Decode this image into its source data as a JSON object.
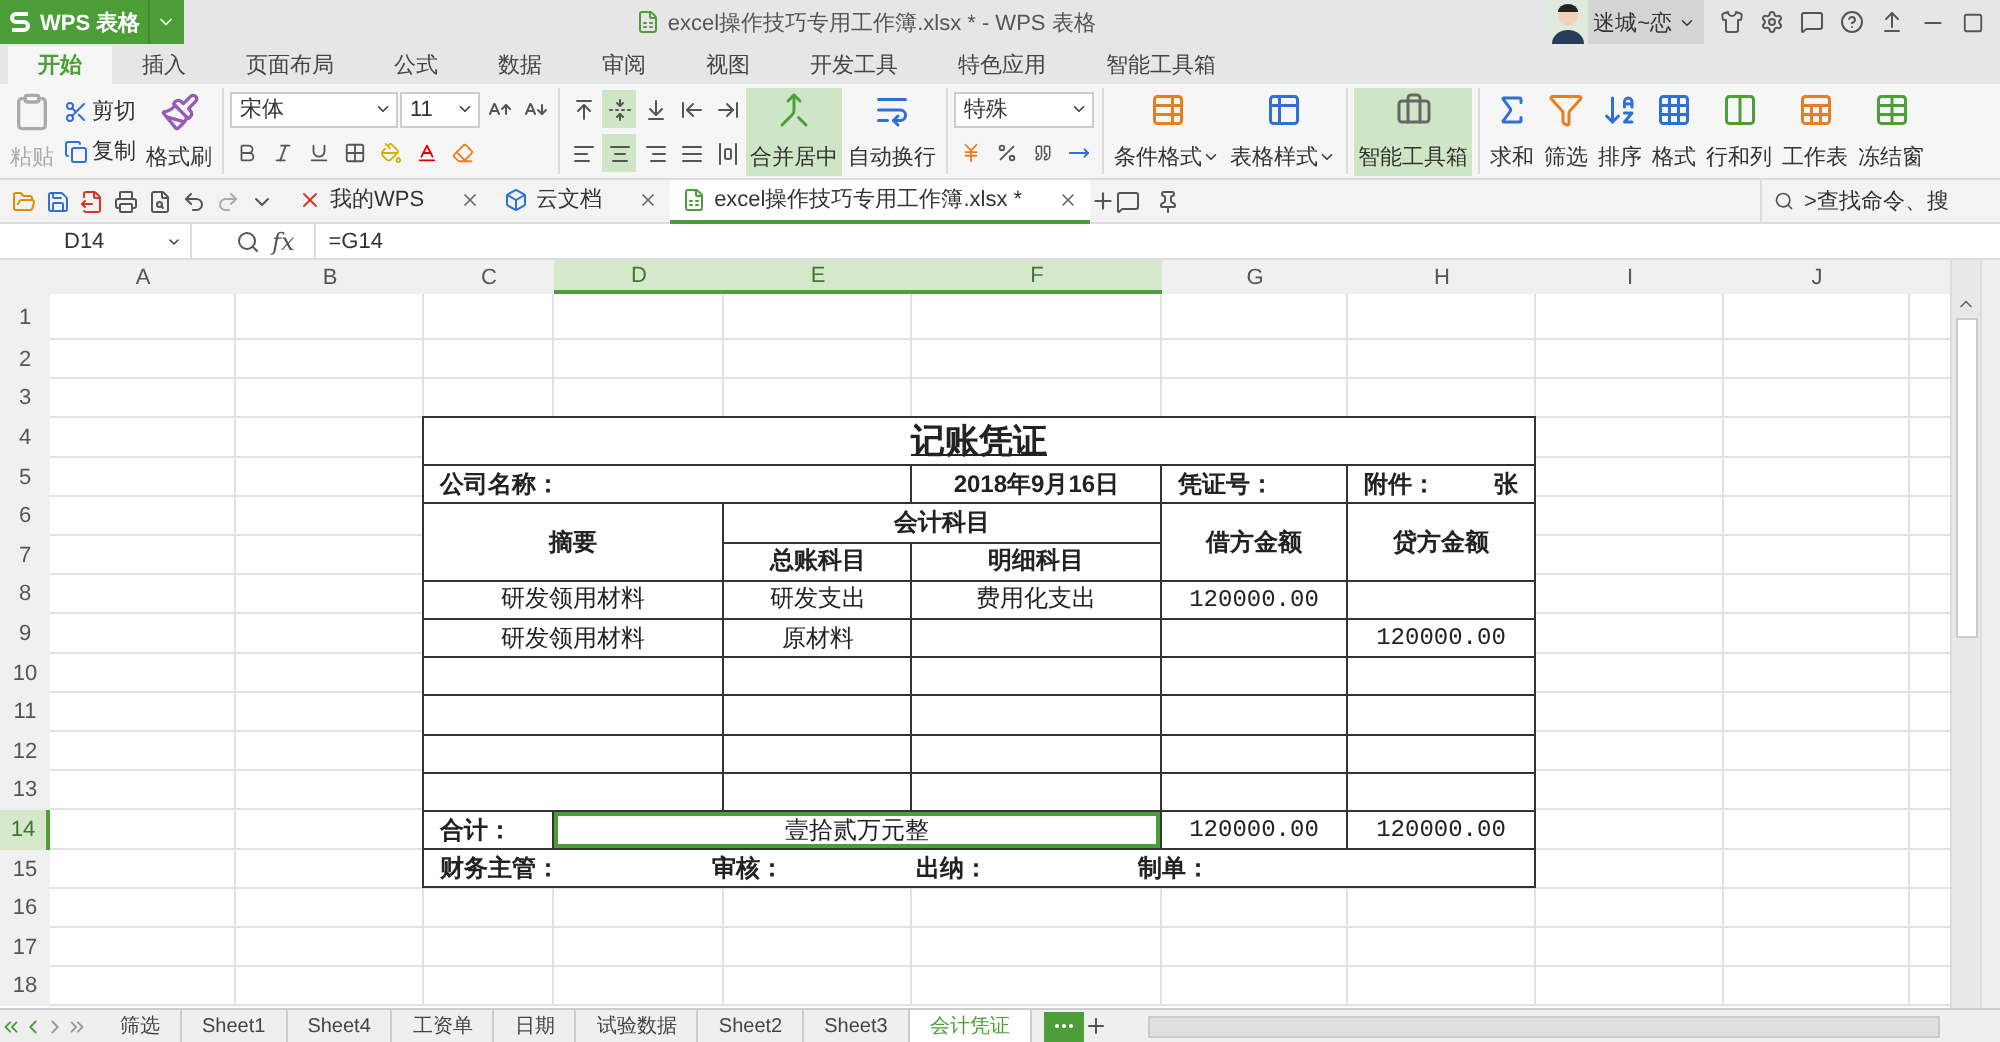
{
  "app_button": {
    "label": "WPS 表格"
  },
  "window": {
    "title": "excel操作技巧专用工作簿.xlsx * - WPS 表格"
  },
  "user": {
    "name": "迷城~恋"
  },
  "ribbon_tabs": [
    {
      "label": "开始",
      "selected": true
    },
    {
      "label": "插入",
      "selected": false
    },
    {
      "label": "页面布局",
      "selected": false
    },
    {
      "label": "公式",
      "selected": false
    },
    {
      "label": "数据",
      "selected": false
    },
    {
      "label": "审阅",
      "selected": false
    },
    {
      "label": "视图",
      "selected": false
    },
    {
      "label": "开发工具",
      "selected": false
    },
    {
      "label": "特色应用",
      "selected": false
    },
    {
      "label": "智能工具箱",
      "selected": false
    }
  ],
  "ribbon": {
    "paste": {
      "label": "粘贴",
      "disabled": true
    },
    "cut": "剪切",
    "copy": "复制",
    "format_painter": "格式刷",
    "font_name": "宋体",
    "font_size": "11",
    "alignment": [
      {
        "kind": "top",
        "selected": false
      },
      {
        "kind": "middle",
        "selected": true
      },
      {
        "kind": "bottom",
        "selected": false
      },
      {
        "kind": "outdent",
        "selected": false
      },
      {
        "kind": "indent",
        "selected": false
      },
      {
        "kind": "left",
        "selected": false
      },
      {
        "kind": "center",
        "selected": true
      },
      {
        "kind": "right",
        "selected": false
      },
      {
        "kind": "justify",
        "selected": false
      },
      {
        "kind": "distributed",
        "selected": false
      }
    ],
    "merge": {
      "label": "合并居中",
      "on": true
    },
    "wrap": "自动换行",
    "number_format": "特殊",
    "styles": [
      "条件格式",
      "表格样式"
    ],
    "toolbox": {
      "label": "智能工具箱",
      "on": true
    },
    "editing": [
      {
        "kind": "sum",
        "label": "求和"
      },
      {
        "kind": "filter",
        "label": "筛选"
      },
      {
        "kind": "sort",
        "label": "排序"
      },
      {
        "kind": "format",
        "label": "格式"
      },
      {
        "kind": "rowscols",
        "label": "行和列"
      },
      {
        "kind": "sheet",
        "label": "工作表"
      },
      {
        "kind": "freeze",
        "label": "冻结窗"
      }
    ]
  },
  "doc_tabs": [
    {
      "kind": "wps",
      "label": "我的WPS",
      "selected": false
    },
    {
      "kind": "cloud",
      "label": "云文档",
      "selected": false
    },
    {
      "kind": "sheet",
      "label": "excel操作技巧专用工作簿.xlsx *",
      "selected": true
    }
  ],
  "command_search": {
    "placeholder": ">查找命令、搜"
  },
  "formula_bar": {
    "cell": "D14",
    "fx": "fx",
    "formula": "=G14"
  },
  "sheet": {
    "columns": [
      {
        "label": "A",
        "selected": false
      },
      {
        "label": "B",
        "selected": false
      },
      {
        "label": "C",
        "selected": false
      },
      {
        "label": "D",
        "selected": true
      },
      {
        "label": "E",
        "selected": true
      },
      {
        "label": "F",
        "selected": true
      },
      {
        "label": "G",
        "selected": false
      },
      {
        "label": "H",
        "selected": false
      },
      {
        "label": "I",
        "selected": false
      },
      {
        "label": "J",
        "selected": false
      }
    ],
    "rows": [
      {
        "label": "1",
        "selected": false
      },
      {
        "label": "2",
        "selected": false
      },
      {
        "label": "3",
        "selected": false
      },
      {
        "label": "4",
        "selected": false
      },
      {
        "label": "5",
        "selected": false
      },
      {
        "label": "6",
        "selected": false
      },
      {
        "label": "7",
        "selected": false
      },
      {
        "label": "8",
        "selected": false
      },
      {
        "label": "9",
        "selected": false
      },
      {
        "label": "10",
        "selected": false
      },
      {
        "label": "11",
        "selected": false
      },
      {
        "label": "12",
        "selected": false
      },
      {
        "label": "13",
        "selected": false
      },
      {
        "label": "14",
        "selected": true
      },
      {
        "label": "15",
        "selected": false
      },
      {
        "label": "16",
        "selected": false
      },
      {
        "label": "17",
        "selected": false
      },
      {
        "label": "18",
        "selected": false
      }
    ],
    "voucher": {
      "title": "记账凭证",
      "company_label": "公司名称：",
      "date": "2018年9月16日",
      "number_label": "凭证号：",
      "attachment_label": "附件：",
      "attachment_unit": "张",
      "headers": {
        "summary": "摘要",
        "accounts": "会计科目",
        "general": "总账科目",
        "detail": "明细科目",
        "debit": "借方金额",
        "credit": "贷方金额"
      },
      "lines": [
        {
          "summary": "研发领用材料",
          "general": "研发支出",
          "detail": "费用化支出",
          "debit": "120000.00"
        },
        {
          "summary": "研发领用材料",
          "general": "原材料",
          "credit": "120000.00"
        }
      ],
      "total": {
        "label": "合计：",
        "amount_words": "壹拾贰万元整",
        "selected": true,
        "debit": "120000.00",
        "credit": "120000.00"
      },
      "signatures": [
        "财务主管：",
        "审核：",
        "出纳：",
        "制单："
      ]
    }
  },
  "sheet_tabs": [
    {
      "label": "筛选",
      "selected": false
    },
    {
      "label": "Sheet1",
      "selected": false
    },
    {
      "label": "Sheet4",
      "selected": false
    },
    {
      "label": "工资单",
      "selected": false
    },
    {
      "label": "日期",
      "selected": false
    },
    {
      "label": "试验数据",
      "selected": false
    },
    {
      "label": "Sheet2",
      "selected": false
    },
    {
      "label": "Sheet3",
      "selected": false
    },
    {
      "label": "会计凭证",
      "selected": true
    }
  ]
}
